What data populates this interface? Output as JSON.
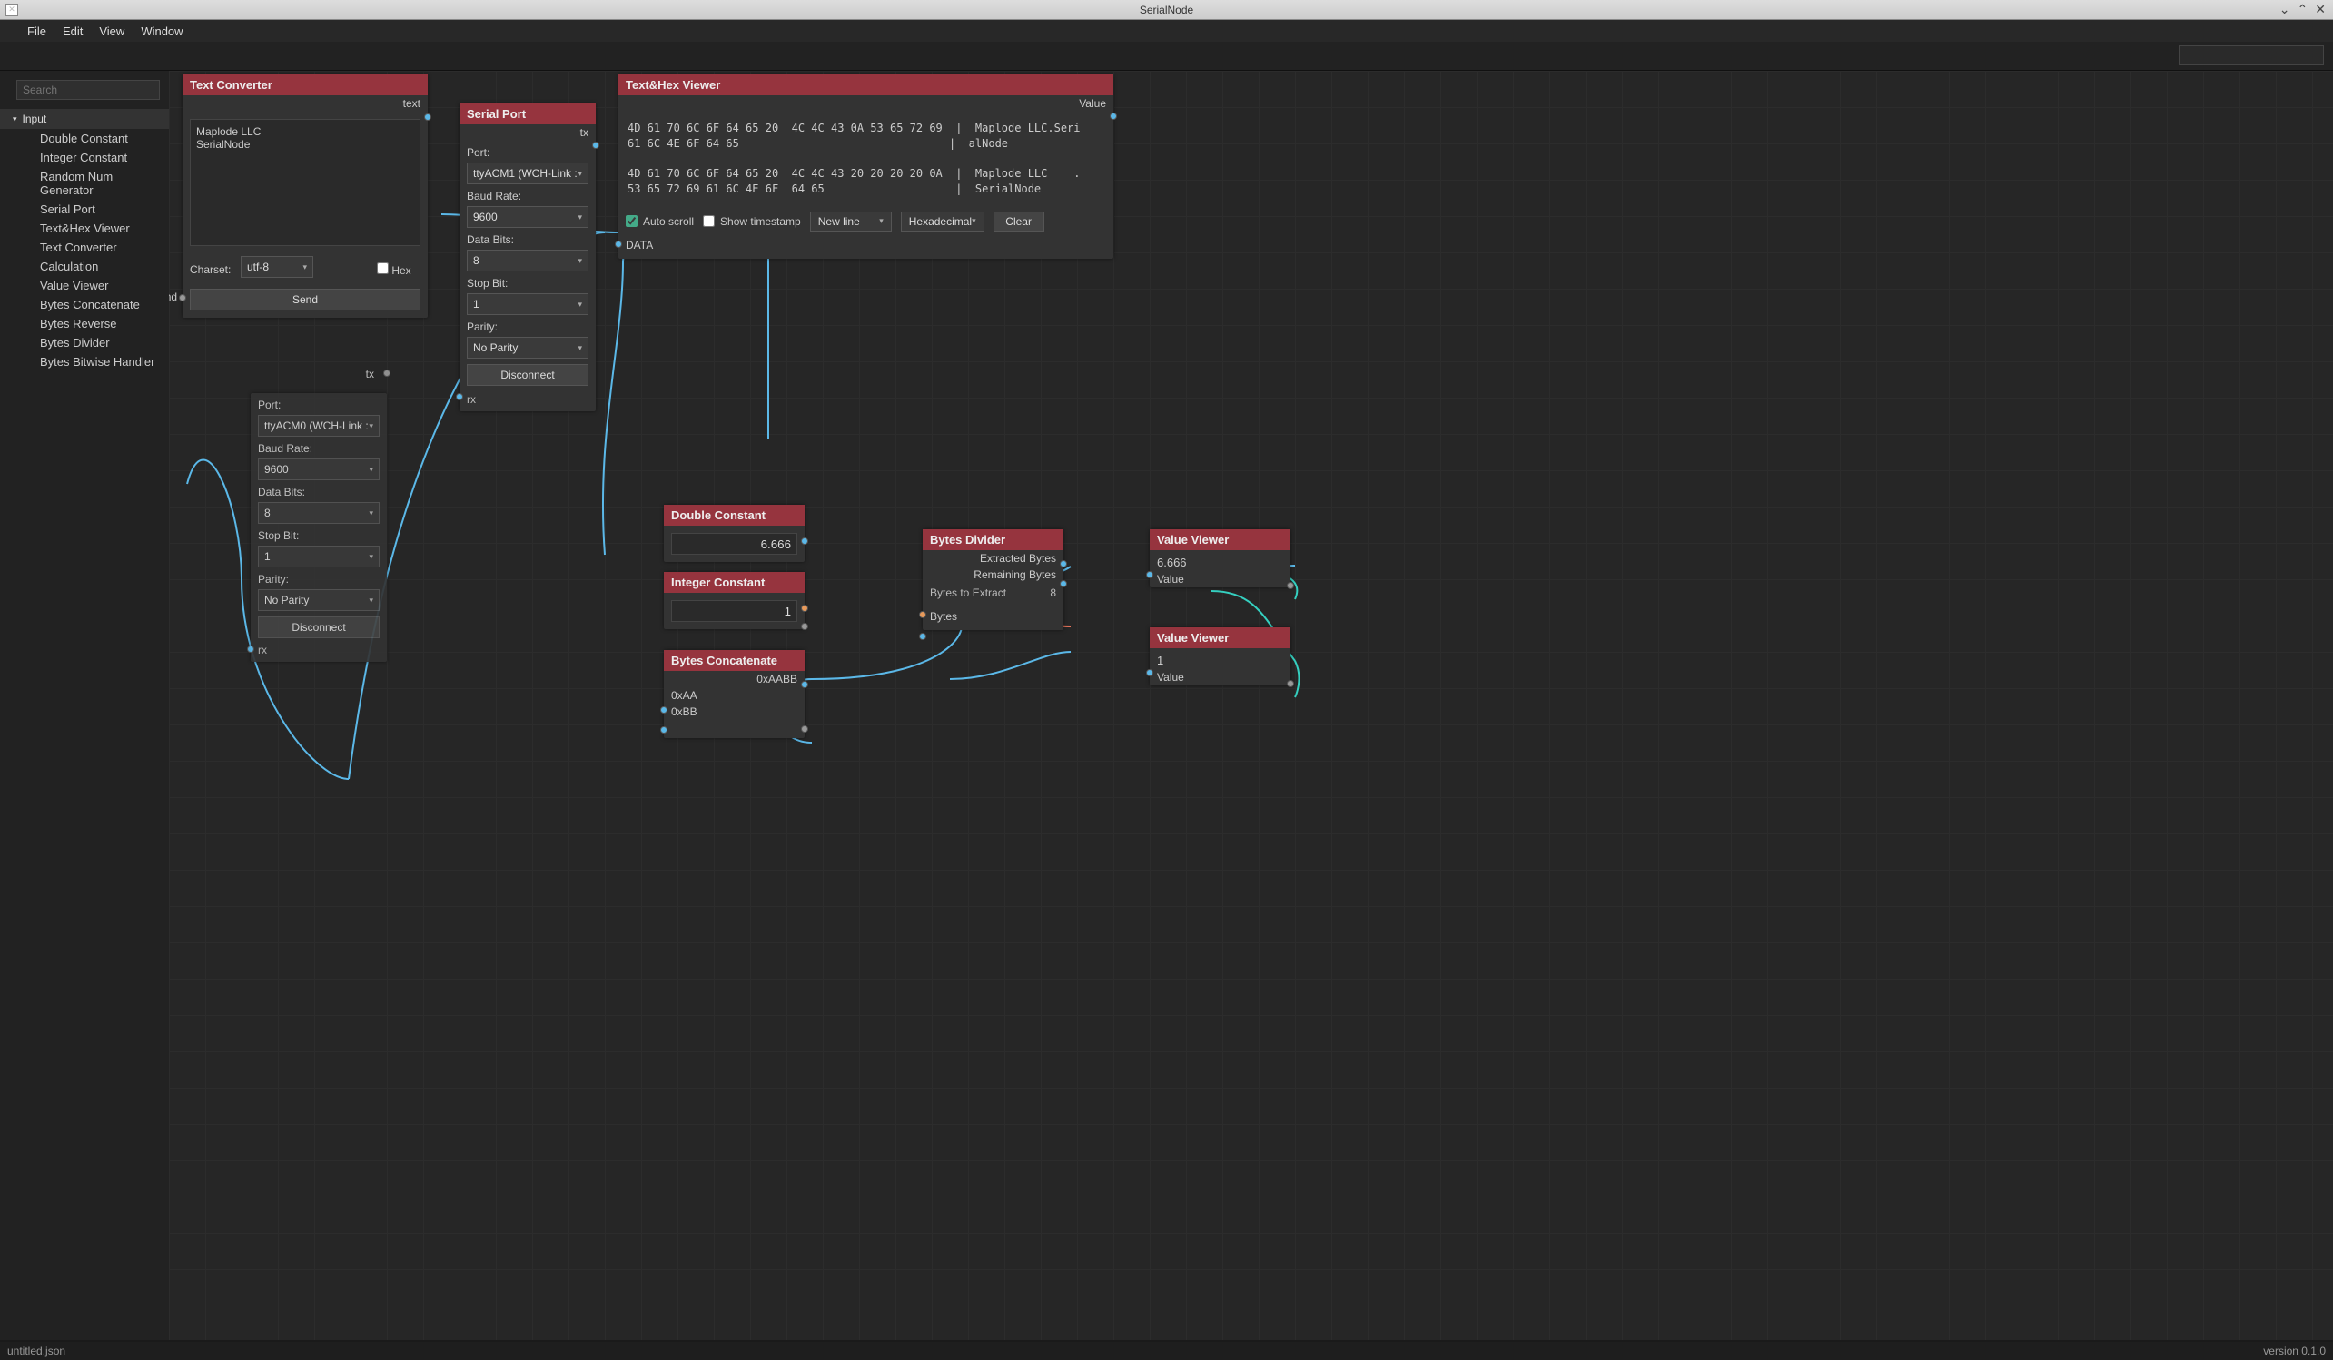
{
  "window": {
    "title": "SerialNode"
  },
  "menu": {
    "file": "File",
    "edit": "Edit",
    "view": "View",
    "window": "Window"
  },
  "sidebar": {
    "search_placeholder": "Search",
    "category": "Input",
    "items": [
      "Double Constant",
      "Integer Constant",
      "Random Num Generator",
      "Serial Port",
      "Text&Hex Viewer",
      "Text Converter",
      "Calculation",
      "Value Viewer",
      "Bytes Concatenate",
      "Bytes Reverse",
      "Bytes Divider",
      "Bytes Bitwise Handler"
    ]
  },
  "nodes": {
    "text_converter": {
      "title": "Text Converter",
      "port_text": "text",
      "textarea": "Maplode LLC\nSerialNode",
      "charset_label": "Charset:",
      "charset_value": "utf-8",
      "hex_label": "Hex",
      "send": "Send",
      "prepend": "prepend"
    },
    "serial_port_left": {
      "port_label": "Port:",
      "port_value": "ttyACM0 (WCH-Link :",
      "baud_label": "Baud Rate:",
      "baud_value": "9600",
      "databits_label": "Data Bits:",
      "databits_value": "8",
      "stopbit_label": "Stop Bit:",
      "stopbit_value": "1",
      "parity_label": "Parity:",
      "parity_value": "No Parity",
      "disconnect": "Disconnect",
      "rx": "rx",
      "tx": "tx"
    },
    "serial_port_right": {
      "title": "Serial Port",
      "port_label": "Port:",
      "port_value": "ttyACM1 (WCH-Link :",
      "baud_label": "Baud Rate:",
      "baud_value": "9600",
      "databits_label": "Data Bits:",
      "databits_value": "8",
      "stopbit_label": "Stop Bit:",
      "stopbit_value": "1",
      "parity_label": "Parity:",
      "parity_value": "No Parity",
      "disconnect": "Disconnect",
      "tx": "tx",
      "rx": "rx"
    },
    "texthex_viewer": {
      "title": "Text&Hex Viewer",
      "port_value": "Value",
      "hexdump": "4D 61 70 6C 6F 64 65 20  4C 4C 43 0A 53 65 72 69  |  Maplode LLC.Seri\n61 6C 4E 6F 64 65                                |  alNode\n\n4D 61 70 6C 6F 64 65 20  4C 4C 43 20 20 20 20 0A  |  Maplode LLC    .\n53 65 72 69 61 6C 4E 6F  64 65                    |  SerialNode",
      "autoscroll": "Auto scroll",
      "timestamp": "Show timestamp",
      "newline": "New line",
      "hexadecimal": "Hexadecimal",
      "clear": "Clear",
      "data": "DATA"
    },
    "double_constant": {
      "title": "Double Constant",
      "value": "6.666"
    },
    "integer_constant": {
      "title": "Integer Constant",
      "value": "1"
    },
    "bytes_concatenate": {
      "title": "Bytes Concatenate",
      "out": "0xAABB",
      "in1": "0xAA",
      "in2": "0xBB"
    },
    "bytes_divider": {
      "title": "Bytes Divider",
      "extracted": "Extracted Bytes",
      "remaining": "Remaining Bytes",
      "to_extract_label": "Bytes to Extract",
      "to_extract_value": "8",
      "bytes": "Bytes"
    },
    "value_viewer1": {
      "title": "Value Viewer",
      "value": "6.666",
      "port": "Value"
    },
    "value_viewer2": {
      "title": "Value Viewer",
      "value": "1",
      "port": "Value"
    }
  },
  "status": {
    "file": "untitled.json",
    "version": "version 0.1.0"
  }
}
